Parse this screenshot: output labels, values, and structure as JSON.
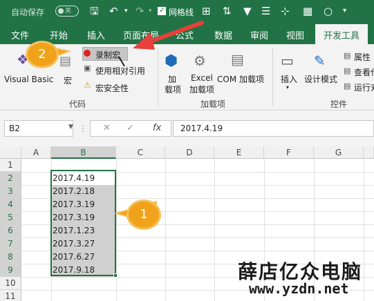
{
  "titlebar": {
    "autosave_label": "自动保存",
    "autosave_state": "关",
    "gridlines_label": "网格线"
  },
  "tabs": [
    "文件",
    "开始",
    "插入",
    "页面布局",
    "公式",
    "数据",
    "审阅",
    "视图",
    "开发工具"
  ],
  "ribbon": {
    "visual_basic": "Visual Basic",
    "macros": "宏",
    "record_macro": "录制宏",
    "relative_refs": "使用相对引用",
    "macro_security": "宏安全性",
    "group_code": "代码",
    "addins": [
      "加",
      "载项"
    ],
    "excel_addins": [
      "Excel",
      "加载项"
    ],
    "com_addins": "COM 加载项",
    "group_addins": "加载项",
    "insert": "插入",
    "design_mode": "设计模式",
    "properties": "属性",
    "view_code": "查看代",
    "run_dialog": "运行对",
    "group_controls": "控件"
  },
  "formula_bar": {
    "name_box": "B2",
    "fx": "fx",
    "formula": "2017.4.19"
  },
  "grid": {
    "columns": [
      "A",
      "B",
      "C",
      "D",
      "E",
      "F",
      "G"
    ],
    "rows": [
      "1",
      "2",
      "3",
      "4",
      "5",
      "6",
      "7",
      "8",
      "9",
      "10",
      "11"
    ],
    "b_values": [
      "2017.4.19",
      "2017.2.18",
      "2017.3.19",
      "2017.3.19",
      "2017.1.23",
      "2017.3.27",
      "2017.6.27",
      "2017.9.18"
    ]
  },
  "callouts": {
    "one": "1",
    "two": "2"
  },
  "watermark": {
    "line1": "薛店亿众电脑",
    "line2": "www.yzdn.net"
  },
  "colors": {
    "excel_green": "#217346",
    "callout_orange": "#f0a31a",
    "arrow_red": "#e8403a"
  }
}
